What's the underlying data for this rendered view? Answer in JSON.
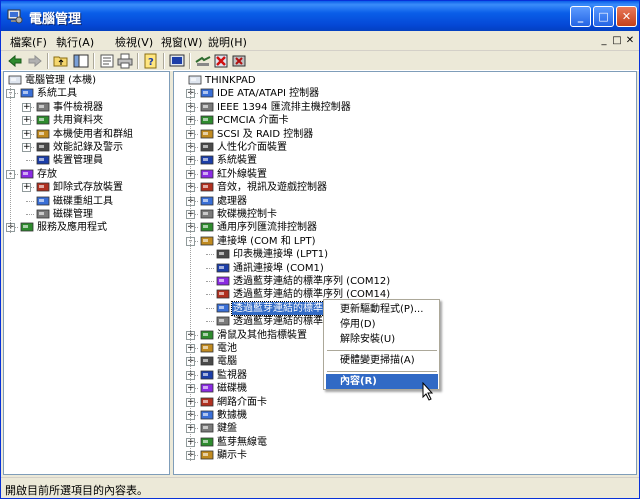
{
  "window": {
    "title": "電腦管理",
    "controls": {
      "minimize": "_",
      "maximize": "□",
      "close": "✕"
    }
  },
  "menubar": {
    "items": [
      "檔案(F)",
      "執行(A)",
      "檢視(V)",
      "視窗(W)",
      "說明(H)"
    ],
    "mdi": [
      "_",
      "□",
      "✕"
    ]
  },
  "toolbar": {
    "icons": [
      "back-arrow-icon",
      "forward-arrow-icon",
      "up-folder-icon",
      "show-hide-tree-icon",
      "properties-icon",
      "print-icon",
      "help-icon",
      "console-icon",
      "scan-hardware-icon",
      "uninstall-icon",
      "disable-icon"
    ]
  },
  "left_tree": {
    "root": "電腦管理 (本機)",
    "items": [
      {
        "label": "系統工具",
        "level": 1,
        "expander": "-"
      },
      {
        "label": "事件檢視器",
        "level": 2,
        "expander": "+"
      },
      {
        "label": "共用資料夾",
        "level": 2,
        "expander": "+"
      },
      {
        "label": "本機使用者和群組",
        "level": 2,
        "expander": "+"
      },
      {
        "label": "效能記錄及警示",
        "level": 2,
        "expander": "+"
      },
      {
        "label": "裝置管理員",
        "level": 2,
        "expander": ""
      },
      {
        "label": "存放",
        "level": 1,
        "expander": "-"
      },
      {
        "label": "卸除式存放裝置",
        "level": 2,
        "expander": "+"
      },
      {
        "label": "磁碟重組工具",
        "level": 2,
        "expander": ""
      },
      {
        "label": "磁碟管理",
        "level": 2,
        "expander": ""
      },
      {
        "label": "服務及應用程式",
        "level": 1,
        "expander": "+"
      }
    ]
  },
  "right_tree": {
    "root": "THINKPAD",
    "items": [
      {
        "label": "IDE ATA/ATAPI 控制器",
        "level": 1,
        "expander": "+"
      },
      {
        "label": "IEEE 1394 匯流排主機控制器",
        "level": 1,
        "expander": "+"
      },
      {
        "label": "PCMCIA 介面卡",
        "level": 1,
        "expander": "+"
      },
      {
        "label": "SCSI 及 RAID 控制器",
        "level": 1,
        "expander": "+"
      },
      {
        "label": "人性化介面裝置",
        "level": 1,
        "expander": "+"
      },
      {
        "label": "系統裝置",
        "level": 1,
        "expander": "+"
      },
      {
        "label": "紅外線裝置",
        "level": 1,
        "expander": "+"
      },
      {
        "label": "音效，視訊及遊戲控制器",
        "level": 1,
        "expander": "+"
      },
      {
        "label": "處理器",
        "level": 1,
        "expander": "+"
      },
      {
        "label": "軟碟機控制卡",
        "level": 1,
        "expander": "+"
      },
      {
        "label": "通用序列匯流排控制器",
        "level": 1,
        "expander": "+"
      },
      {
        "label": "連接埠 (COM 和 LPT)",
        "level": 1,
        "expander": "-"
      },
      {
        "label": "印表機連接埠 (LPT1)",
        "level": 2,
        "expander": ""
      },
      {
        "label": "通訊連接埠 (COM1)",
        "level": 2,
        "expander": ""
      },
      {
        "label": "透過藍芽連結的標準序列 (COM12)",
        "level": 2,
        "expander": ""
      },
      {
        "label": "透過藍芽連結的標準序列 (COM14)",
        "level": 2,
        "expander": ""
      },
      {
        "label": "透過藍芽連結的標準序",
        "level": 2,
        "expander": "",
        "selected": true
      },
      {
        "label": "透過藍芽連結的標準",
        "level": 2,
        "expander": ""
      },
      {
        "label": "滑鼠及其他指標裝置",
        "level": 1,
        "expander": "+"
      },
      {
        "label": "電池",
        "level": 1,
        "expander": "+"
      },
      {
        "label": "電腦",
        "level": 1,
        "expander": "+"
      },
      {
        "label": "監視器",
        "level": 1,
        "expander": "+"
      },
      {
        "label": "磁碟機",
        "level": 1,
        "expander": "+"
      },
      {
        "label": "網路介面卡",
        "level": 1,
        "expander": "+"
      },
      {
        "label": "數據機",
        "level": 1,
        "expander": "+"
      },
      {
        "label": "鍵盤",
        "level": 1,
        "expander": "+"
      },
      {
        "label": "藍芽無線電",
        "level": 1,
        "expander": "+"
      },
      {
        "label": "顯示卡",
        "level": 1,
        "expander": "+"
      }
    ]
  },
  "context_menu": {
    "items": [
      {
        "label": "更新驅動程式(P)...",
        "highlighted": false
      },
      {
        "label": "停用(D)",
        "highlighted": false
      },
      {
        "label": "解除安裝(U)",
        "highlighted": false
      },
      {
        "separator": true
      },
      {
        "label": "硬體變更掃描(A)",
        "highlighted": false
      },
      {
        "separator": true
      },
      {
        "label": "內容(R)",
        "highlighted": true
      }
    ]
  },
  "statusbar": {
    "text": "開啟目前所選項目的內容表。"
  },
  "colors": {
    "title_blue": "#0a5ee8",
    "selection": "#316ac5",
    "face": "#ece9d8"
  }
}
